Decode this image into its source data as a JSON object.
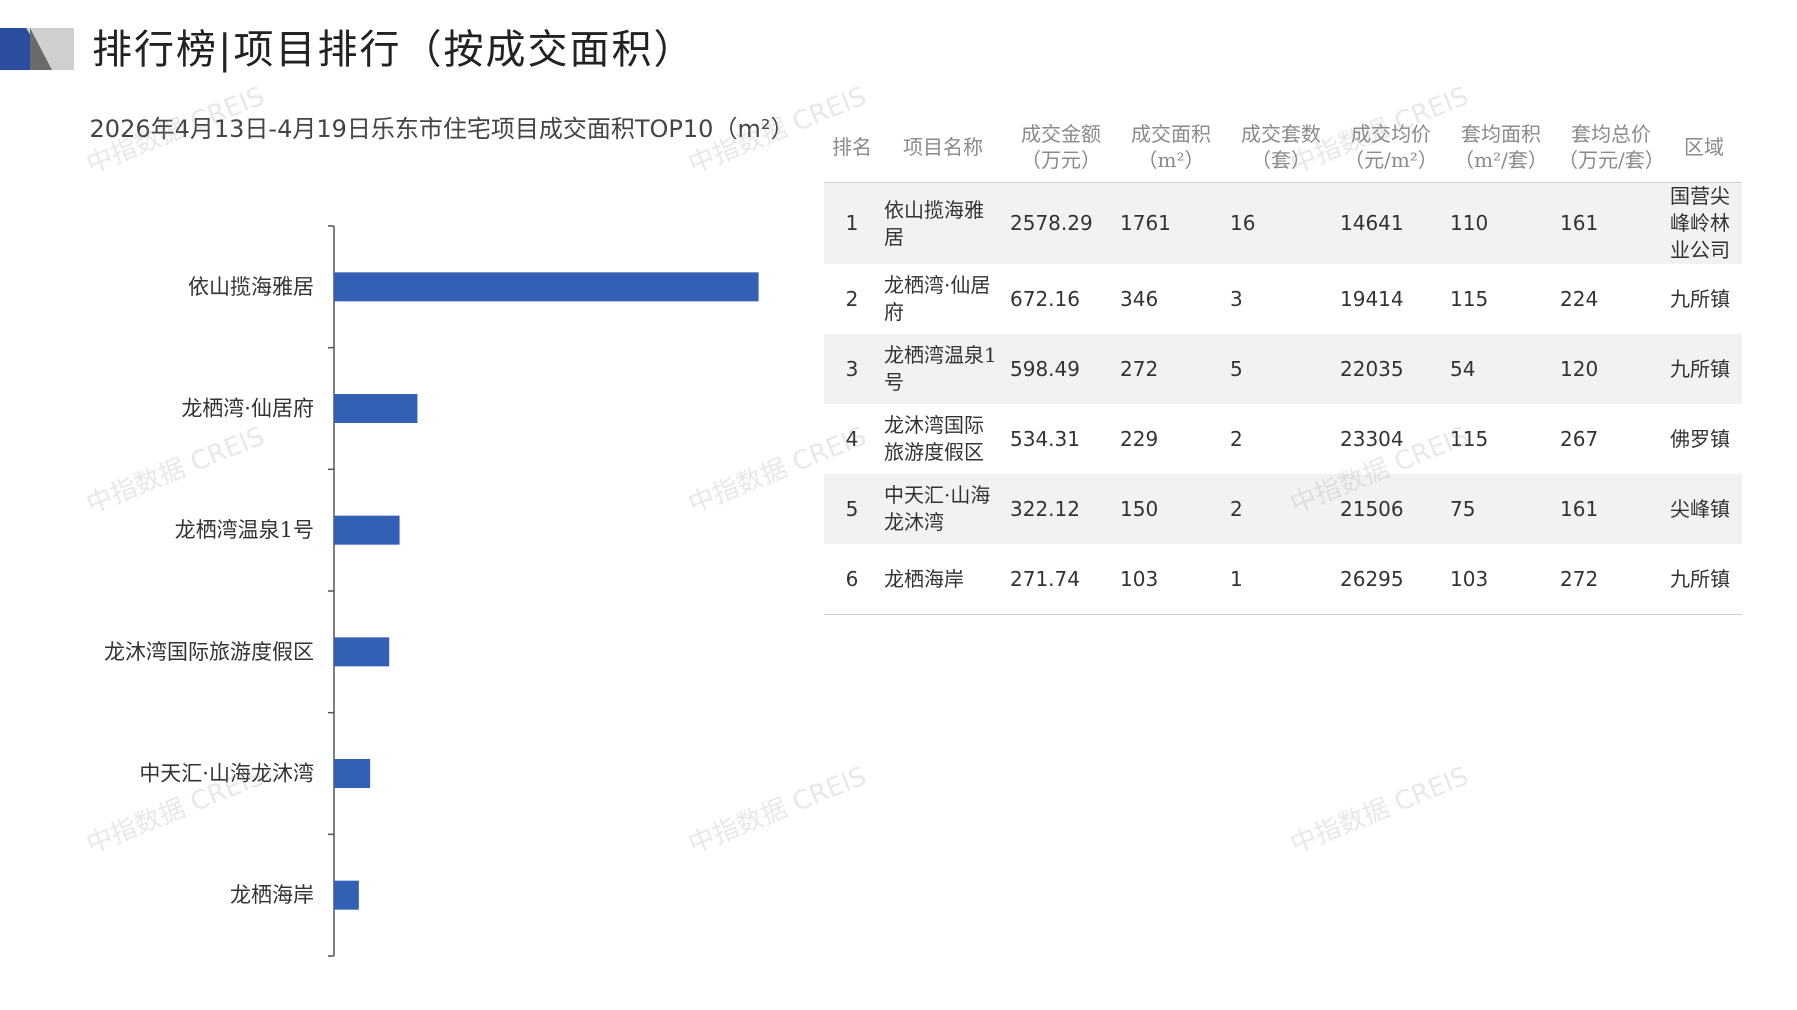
{
  "header": {
    "title": "排行榜|项目排行（按成交面积）"
  },
  "colors": {
    "bar": "#3360b5",
    "accent_dark": "#2b4da0",
    "accent_light": "#d6d6d6"
  },
  "watermark": "中指数据 CREIS",
  "chart_data": {
    "type": "bar",
    "orientation": "horizontal",
    "title": "2026年4月13日-4月19日乐东市住宅项目成交面积TOP10（m²）",
    "categories": [
      "依山揽海雅居",
      "龙栖湾·仙居府",
      "龙栖湾温泉1号",
      "龙沐湾国际旅游度假区",
      "中天汇·山海龙沐湾",
      "龙栖海岸"
    ],
    "values": [
      1761,
      346,
      272,
      229,
      150,
      103
    ],
    "xlim": [
      0,
      1800
    ],
    "grid": false,
    "legend": "none"
  },
  "table": {
    "columns": [
      "排名",
      "项目名称",
      "成交金额（万元）",
      "成交面积（m²）",
      "成交套数（套）",
      "成交均价（元/m²）",
      "套均面积（m²/套）",
      "套均总价（万元/套）",
      "区域"
    ],
    "rows": [
      [
        "1",
        "依山揽海雅居",
        "2578.29",
        "1761",
        "16",
        "14641",
        "110",
        "161",
        "国营尖峰岭林业公司"
      ],
      [
        "2",
        "龙栖湾·仙居府",
        "672.16",
        "346",
        "3",
        "19414",
        "115",
        "224",
        "九所镇"
      ],
      [
        "3",
        "龙栖湾温泉1号",
        "598.49",
        "272",
        "5",
        "22035",
        "54",
        "120",
        "九所镇"
      ],
      [
        "4",
        "龙沐湾国际旅游度假区",
        "534.31",
        "229",
        "2",
        "23304",
        "115",
        "267",
        "佛罗镇"
      ],
      [
        "5",
        "中天汇·山海龙沐湾",
        "322.12",
        "150",
        "2",
        "21506",
        "75",
        "161",
        "尖峰镇"
      ],
      [
        "6",
        "龙栖海岸",
        "271.74",
        "103",
        "1",
        "26295",
        "103",
        "272",
        "九所镇"
      ]
    ]
  }
}
